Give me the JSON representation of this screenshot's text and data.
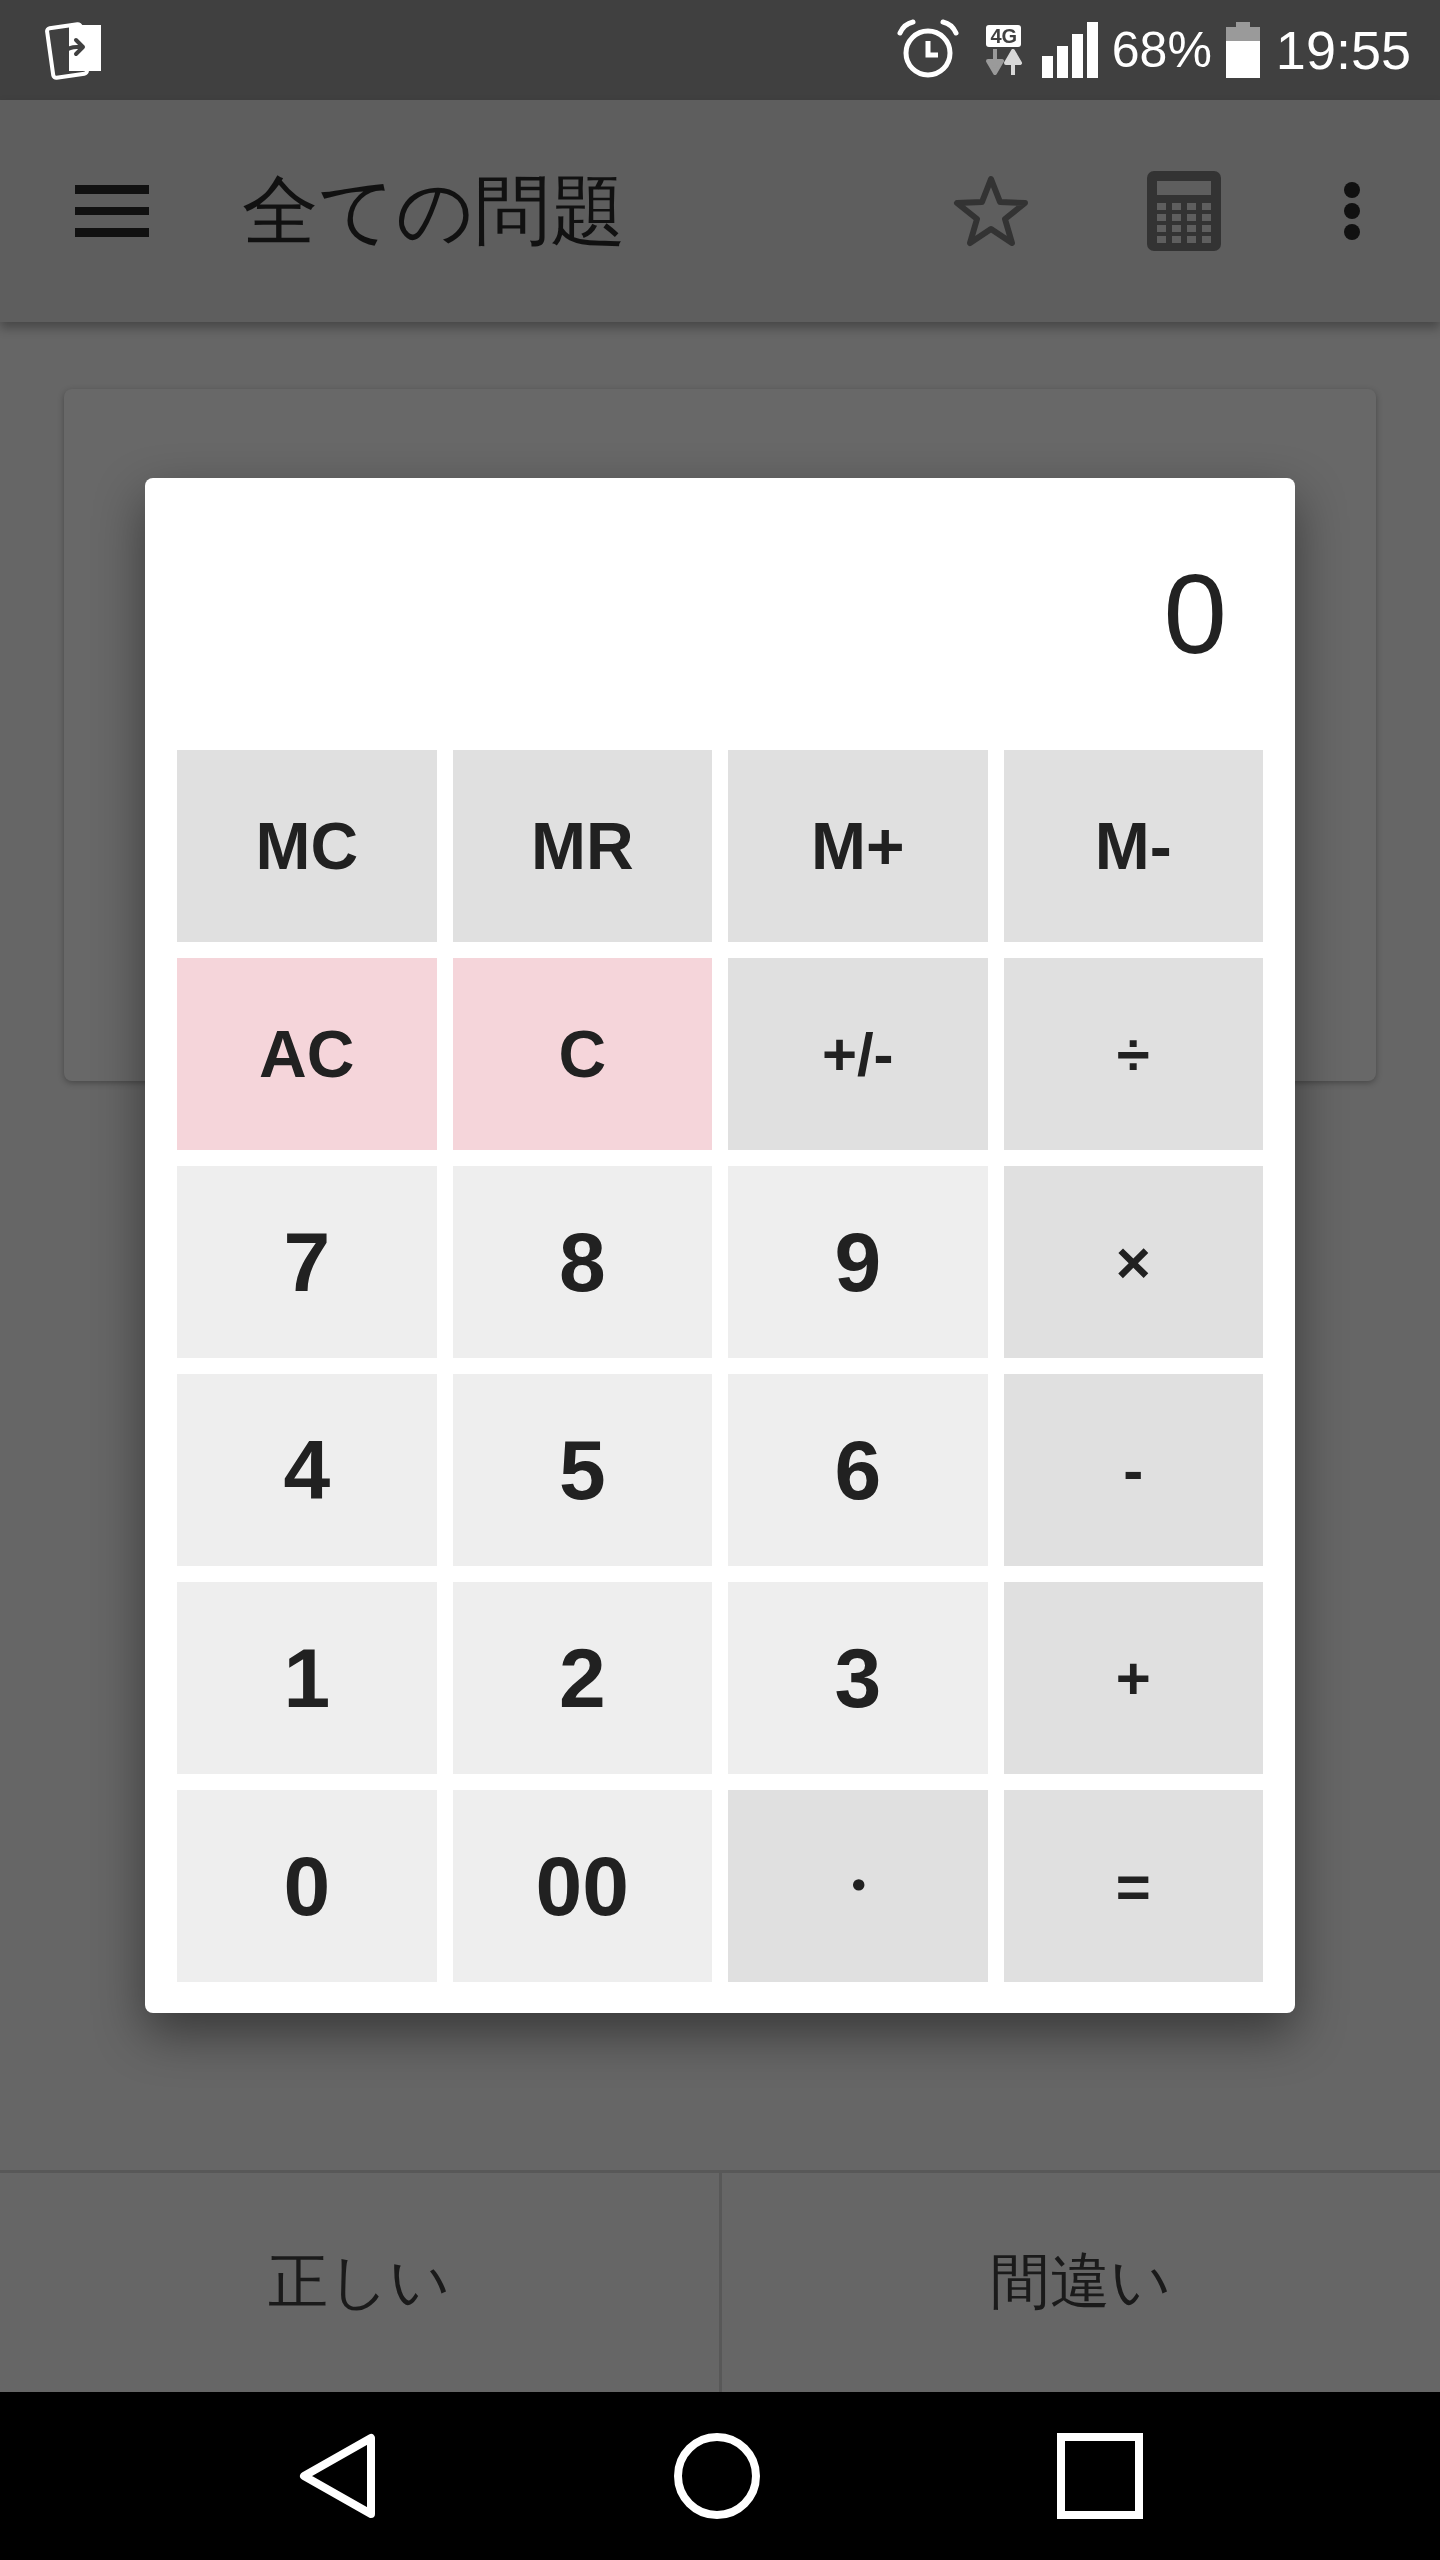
{
  "status_bar": {
    "network": "4G",
    "battery": "68%",
    "time": "19:55"
  },
  "app_bar": {
    "title": "全ての問題"
  },
  "calculator": {
    "display": "0",
    "keys": [
      {
        "label": "MC",
        "kind": "memory"
      },
      {
        "label": "MR",
        "kind": "memory"
      },
      {
        "label": "M+",
        "kind": "memory"
      },
      {
        "label": "M-",
        "kind": "memory"
      },
      {
        "label": "AC",
        "kind": "clear"
      },
      {
        "label": "C",
        "kind": "clear"
      },
      {
        "label": "+/-",
        "kind": "function"
      },
      {
        "label": "÷",
        "kind": "function"
      },
      {
        "label": "7",
        "kind": "digit"
      },
      {
        "label": "8",
        "kind": "digit"
      },
      {
        "label": "9",
        "kind": "digit"
      },
      {
        "label": "×",
        "kind": "function"
      },
      {
        "label": "4",
        "kind": "digit"
      },
      {
        "label": "5",
        "kind": "digit"
      },
      {
        "label": "6",
        "kind": "digit"
      },
      {
        "label": "-",
        "kind": "function"
      },
      {
        "label": "1",
        "kind": "digit"
      },
      {
        "label": "2",
        "kind": "digit"
      },
      {
        "label": "3",
        "kind": "digit"
      },
      {
        "label": "+",
        "kind": "function"
      },
      {
        "label": "0",
        "kind": "digit"
      },
      {
        "label": "00",
        "kind": "digit"
      },
      {
        "label": "・",
        "kind": "function"
      },
      {
        "label": "=",
        "kind": "function"
      }
    ]
  },
  "answer_buttons": [
    "正しい",
    "間違い"
  ]
}
